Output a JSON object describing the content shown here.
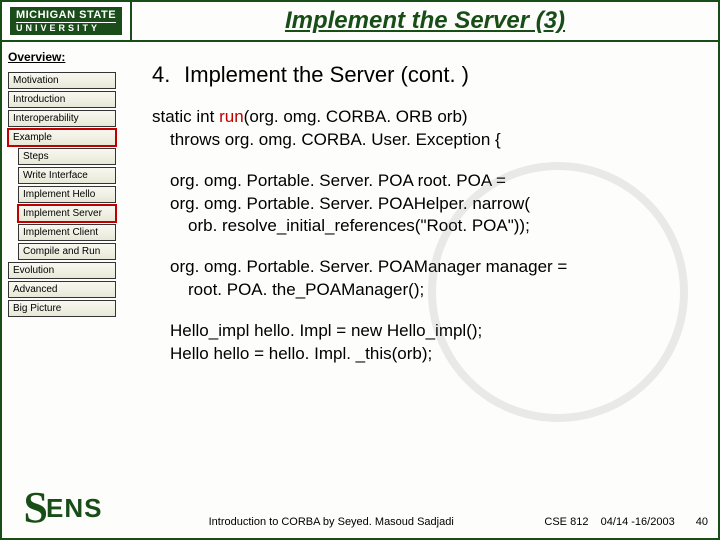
{
  "logo": {
    "line1": "MICHIGAN STATE",
    "line2": "UNIVERSITY"
  },
  "title": "Implement the Server (3)",
  "sidebar": {
    "overview": "Overview:",
    "items": [
      {
        "label": "Motivation",
        "sub": false,
        "hl": false
      },
      {
        "label": "Introduction",
        "sub": false,
        "hl": false
      },
      {
        "label": "Interoperability",
        "sub": false,
        "hl": false
      },
      {
        "label": "Example",
        "sub": false,
        "hl": true
      },
      {
        "label": "Steps",
        "sub": true,
        "hl": false
      },
      {
        "label": "Write Interface",
        "sub": true,
        "hl": false
      },
      {
        "label": "Implement Hello",
        "sub": true,
        "hl": false
      },
      {
        "label": "Implement Server",
        "sub": true,
        "hl": true
      },
      {
        "label": "Implement Client",
        "sub": true,
        "hl": false
      },
      {
        "label": "Compile and Run",
        "sub": true,
        "hl": false
      },
      {
        "label": "Evolution",
        "sub": false,
        "hl": false
      },
      {
        "label": "Advanced",
        "sub": false,
        "hl": false
      },
      {
        "label": "Big Picture",
        "sub": false,
        "hl": false
      }
    ]
  },
  "content": {
    "num": "4.",
    "heading": "Implement the Server (cont. )",
    "sig1": "static int ",
    "run": "run",
    "sig2": "(org. omg. CORBA. ORB orb)",
    "sig3": "throws org. omg. CORBA. User. Exception {",
    "b1l1": "org. omg. Portable. Server. POA root. POA =",
    "b1l2": "org. omg. Portable. Server. POAHelper. narrow(",
    "b1l3": "orb. resolve_initial_references(\"Root. POA\"));",
    "b2l1": "org. omg. Portable. Server. POAManager manager =",
    "b2l2": "root. POA. the_POAManager();",
    "b3l1": "Hello_impl hello. Impl = new Hello_impl();",
    "b3l2": "Hello hello = hello. Impl. _this(orb);"
  },
  "footer": {
    "center": "Introduction to CORBA by Seyed. Masoud Sadjadi",
    "course": "CSE 812",
    "date": "04/14 -16/2003",
    "page": "40"
  }
}
